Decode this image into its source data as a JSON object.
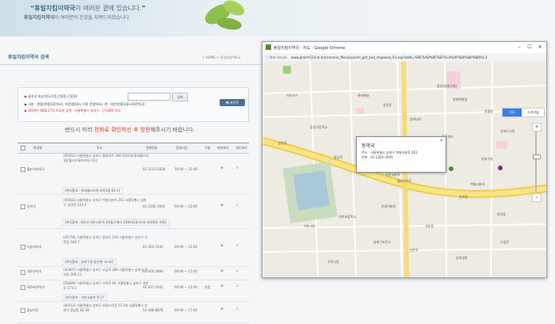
{
  "hero": {
    "slogan_brand": "휴일지킴이약국",
    "slogan_rest": "이 여러분 곁에 있습니다.",
    "sub_brand": "휴일지킴이약국",
    "sub_rest": "이 여러분의 건강을 지켜드리겠습니다."
  },
  "page": {
    "title": "휴일지킴이약국 검색",
    "breadcrumb": "> HOME > 휴일지킴이약국"
  },
  "search": {
    "label": "▶ 결과내 재검색(도로명,건물명,건물명):",
    "input_value": "",
    "button": "검색",
    "line2": "▶ 구분 : 연중(연중무휴약국), 야간(밤10시 이후 운영약국), 연 · 야간(연중무휴+야간약국)",
    "line3": "▶ 2019년 08월 17일 토요일 검색 · 서울특별시 송파구 · 근무예정 약국",
    "print_button": "프린트"
  },
  "notice": {
    "pre": "반드시 미리 ",
    "red": "전화로 확인하신 후 방문",
    "post": "해주시기 바랍니다."
  },
  "table": {
    "headers": [
      "약국명",
      "주소",
      "전화번호",
      "운영시간",
      "구분",
      "위치보기",
      "지도보기"
    ],
    "rows": [
      {
        "name": "월드타워약국",
        "addr": "(05551) 서울특별시 송파구 올림픽로 300 지하1층(롯데월드타워)(월드타워프라자) 약국",
        "phone": "02-3213-2828",
        "hours": "10:00 ~ 22:00",
        "hol": "",
        "note": "[위치정보 : 롯데월드타워 지하1층 B1-1]"
      },
      {
        "name": "동약국",
        "addr": "(05602) 서울특별시 송파구 백제고분로 261 서울특별시 송파구 삼전동 133-4",
        "phone": "02-2202-3941",
        "hours": "09:00 ~ 22:00",
        "hol": "",
        "note": "[위치정보 : 8호선 석촌고분역 1번출구에서 100m(1분거리)-지하철로 이용]"
      },
      {
        "name": "녹십자약국",
        "addr": "(05758) 서울특별시 송파구 중대로 150 서울특별시 송파구 가락동 184-7",
        "phone": "02-424-7434",
        "hours": "09:00 ~ 22:00",
        "hol": "",
        "note": "[위치정보 : 송파구청 맞은편 사거리]"
      },
      {
        "name": "새로온약국",
        "addr": "(05807) 서울특별시 송파구 오금로 380 서울특별시 송파구 거여동 266-13",
        "phone": "02-400-3860",
        "hours": "09:00 ~ 15:00",
        "hol": "",
        "note": ""
      },
      {
        "name": "365바른약국",
        "addr": "(05689) 서울특별시 송파구 가락로 84 서울특별시 송파구 석촌동 273-3",
        "phone": "02-417-1402",
        "hours": "09:00 ~ 21:00",
        "hol": "연중",
        "note": "[위치정보 : 석촌고분역 인근]"
      },
      {
        "name": "풍납약국",
        "addr": "(05512) 서울특별시 송파구 바람드리길 51 1층 서울특별시 송파구 풍납동 82-28",
        "phone": "02-488-8878",
        "hours": "09:00 ~ 17:00",
        "hol": "",
        "note": ""
      }
    ]
  },
  "popup": {
    "window_title": "휴일지킴이약국 - 지도 - Google Chrome",
    "not_secure": "ⓘ Not secure",
    "url": "www.pharm114.or.kr/common_files/asp/xml_get_and_response_03.asp?addr=%BC%AD%BF%EF%C6%AF%BA%B0%BD%C3",
    "map_type": [
      "지도",
      "스카이뷰"
    ],
    "infobox": {
      "name": "동약국",
      "addr": "주소 : 서울특별시 송파구 백제고분로 261",
      "phone": "전화 : 02-2202-3941"
    },
    "kakao": "kakao",
    "labels": [
      "잠실(송파구청)",
      "석촌고분역",
      "송파구청",
      "석촌고분",
      "석촌초등학교",
      "잠실고등학교",
      "석촌호수",
      "롯데캐슬",
      "삼전동",
      "석촌동",
      "롯데백화점",
      "갈월동",
      "송파동",
      "헬리오아트",
      "주민센터",
      "삼전동",
      "송파구보건소",
      "한양아파트",
      "송파공원",
      "잠실로",
      "백제고분로",
      "석촌역",
      "송파대로",
      "방이동",
      "오금로",
      "가락시장",
      "송파도서관"
    ]
  }
}
